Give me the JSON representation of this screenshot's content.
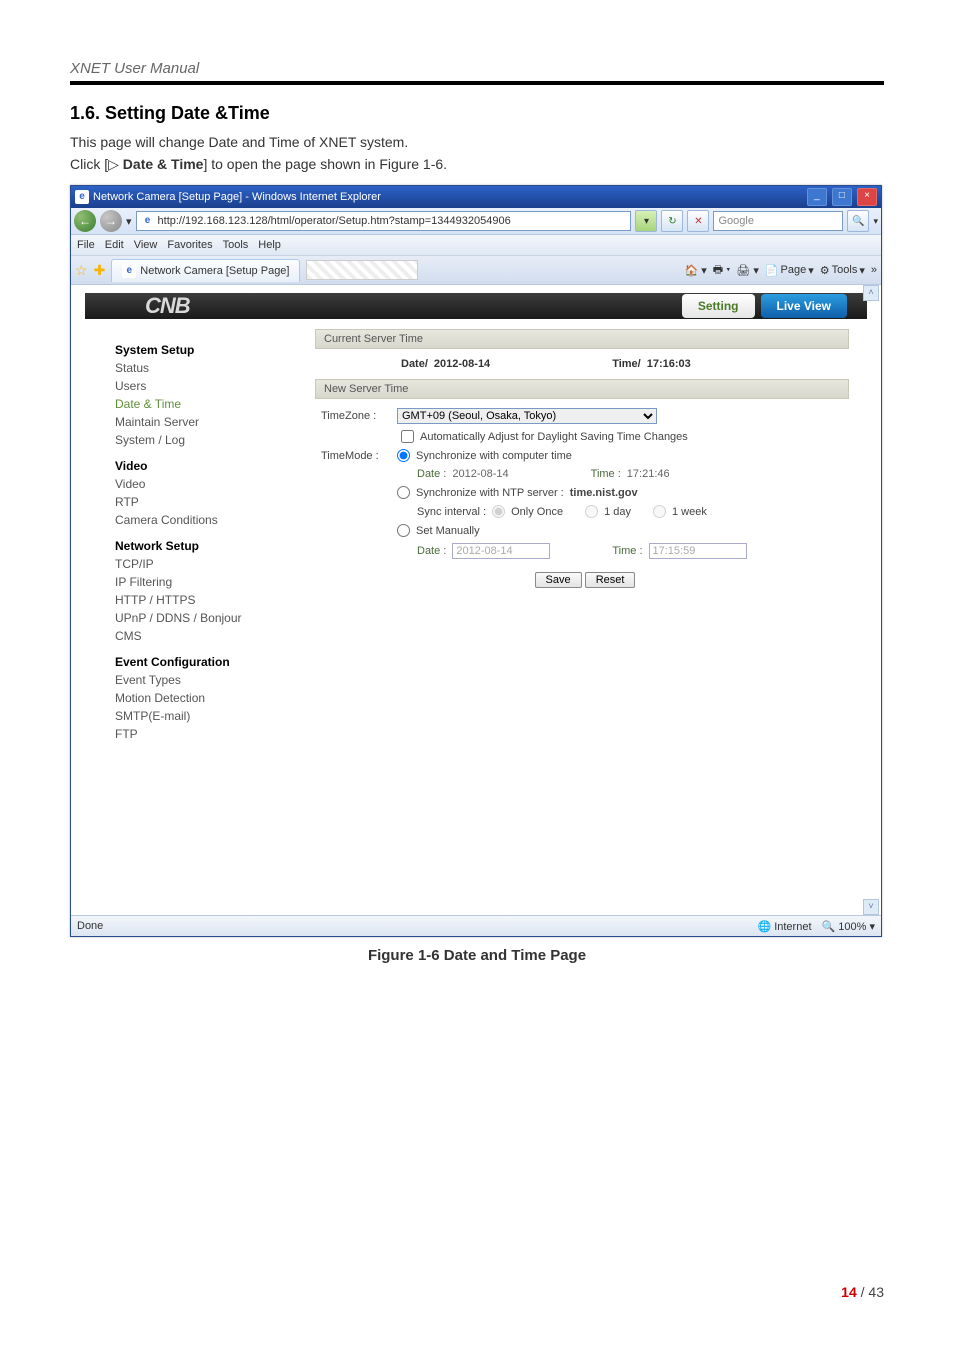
{
  "doc": {
    "header": "XNET User Manual",
    "section_title": "1.6. Setting Date &Time",
    "intro": "This page will change Date and Time of XNET system.",
    "click_prefix": "Click [",
    "click_icon": "▷",
    "click_bold": " Date & Time",
    "click_suffix": "] to open the page shown in Figure 1-6.",
    "figure_caption": "Figure 1-6 Date and Time Page",
    "page_cur": "14",
    "page_sep": " / ",
    "page_total": "43"
  },
  "browser": {
    "title": "Network Camera [Setup Page] - Windows Internet Explorer",
    "url": "http://192.168.123.128/html/operator/Setup.htm?stamp=1344932054906",
    "search_placeholder": "Google",
    "menu": [
      "File",
      "Edit",
      "View",
      "Favorites",
      "Tools",
      "Help"
    ],
    "tab_label": "Network Camera [Setup Page]",
    "toolbar": {
      "page": "Page",
      "tools": "Tools"
    },
    "status_left": "Done",
    "status_zone": "Internet",
    "status_zoom": "100%"
  },
  "app": {
    "logo": "CNB",
    "btn_setting": "Setting",
    "btn_live": "Live View",
    "sidebar": {
      "g1": "System Setup",
      "g1_items": [
        "Status",
        "Users",
        "Date & Time",
        "Maintain Server",
        "System / Log"
      ],
      "g2": "Video",
      "g2_items": [
        "Video",
        "RTP",
        "Camera Conditions"
      ],
      "g3": "Network Setup",
      "g3_items": [
        "TCP/IP",
        "IP Filtering",
        "HTTP / HTTPS",
        "UPnP / DDNS / Bonjour",
        "CMS"
      ],
      "g4": "Event Configuration",
      "g4_items": [
        "Event Types",
        "Motion Detection",
        "SMTP(E-mail)",
        "FTP"
      ]
    },
    "panel": {
      "current_title": "Current Server Time",
      "current_date_label": "Date/",
      "current_date": "2012-08-14",
      "current_time_label": "Time/",
      "current_time": "17:16:03",
      "new_title": "New Server Time",
      "tz_label": "TimeZone :",
      "tz_value": "GMT+09 (Seoul, Osaka, Tokyo)",
      "dst_label": "Automatically Adjust for Daylight Saving Time Changes",
      "tm_label": "TimeMode :",
      "r_sync_pc": "Synchronize with computer time",
      "pc_date_label": "Date :",
      "pc_date": "2012-08-14",
      "pc_time_label": "Time :",
      "pc_time": "17:21:46",
      "r_sync_ntp": "Synchronize with NTP server :",
      "ntp_server": "time.nist.gov",
      "sync_interval_label": "Sync interval :",
      "si_once": "Only Once",
      "si_day": "1 day",
      "si_week": "1 week",
      "r_manual": "Set Manually",
      "man_date_label": "Date :",
      "man_date": "2012-08-14",
      "man_time_label": "Time :",
      "man_time": "17:15:59",
      "btn_save": "Save",
      "btn_reset": "Reset"
    }
  }
}
